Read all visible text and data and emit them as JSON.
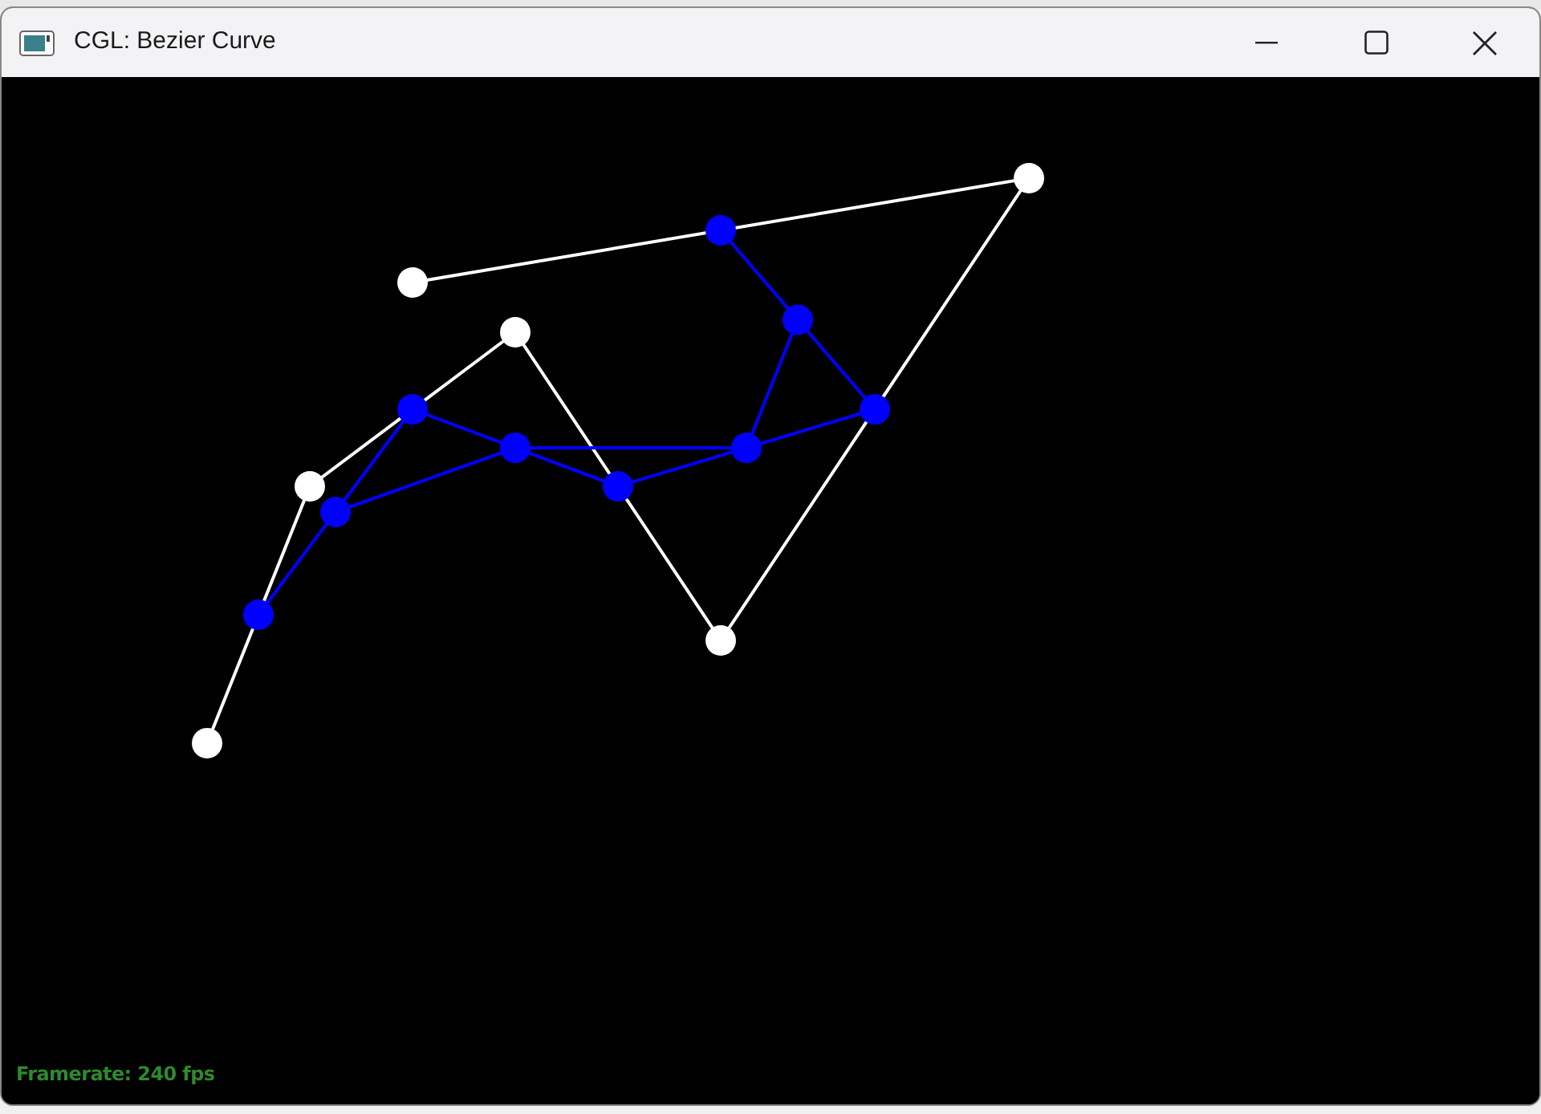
{
  "window": {
    "title": "CGL: Bezier Curve"
  },
  "overlay": {
    "framerate": "Framerate: 240 fps"
  }
}
